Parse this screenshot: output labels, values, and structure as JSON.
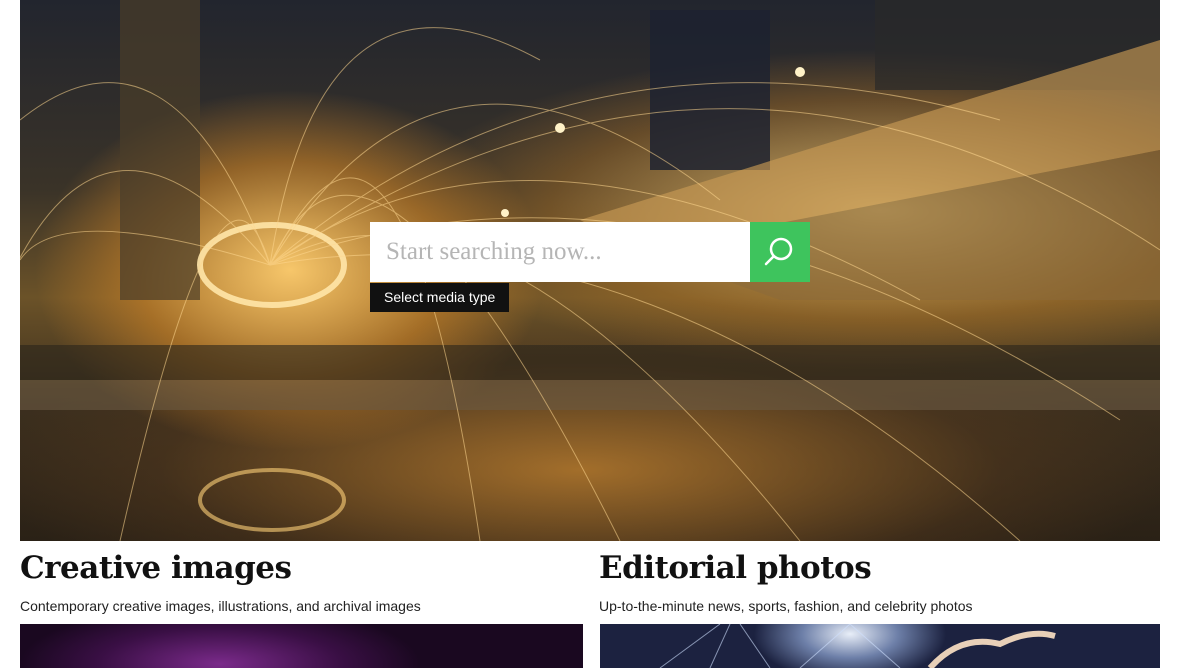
{
  "hero": {
    "search": {
      "placeholder": "Start searching now...",
      "button_icon": "search-icon"
    },
    "media_type_label": "Select media type"
  },
  "sections": [
    {
      "title": "Creative images",
      "description": "Contemporary creative images, illustrations, and archival images"
    },
    {
      "title": "Editorial photos",
      "description": "Up-to-the-minute news, sports, fashion, and celebrity photos"
    }
  ],
  "colors": {
    "accent": "#3ec45d",
    "media_type_bg": "#111111"
  }
}
